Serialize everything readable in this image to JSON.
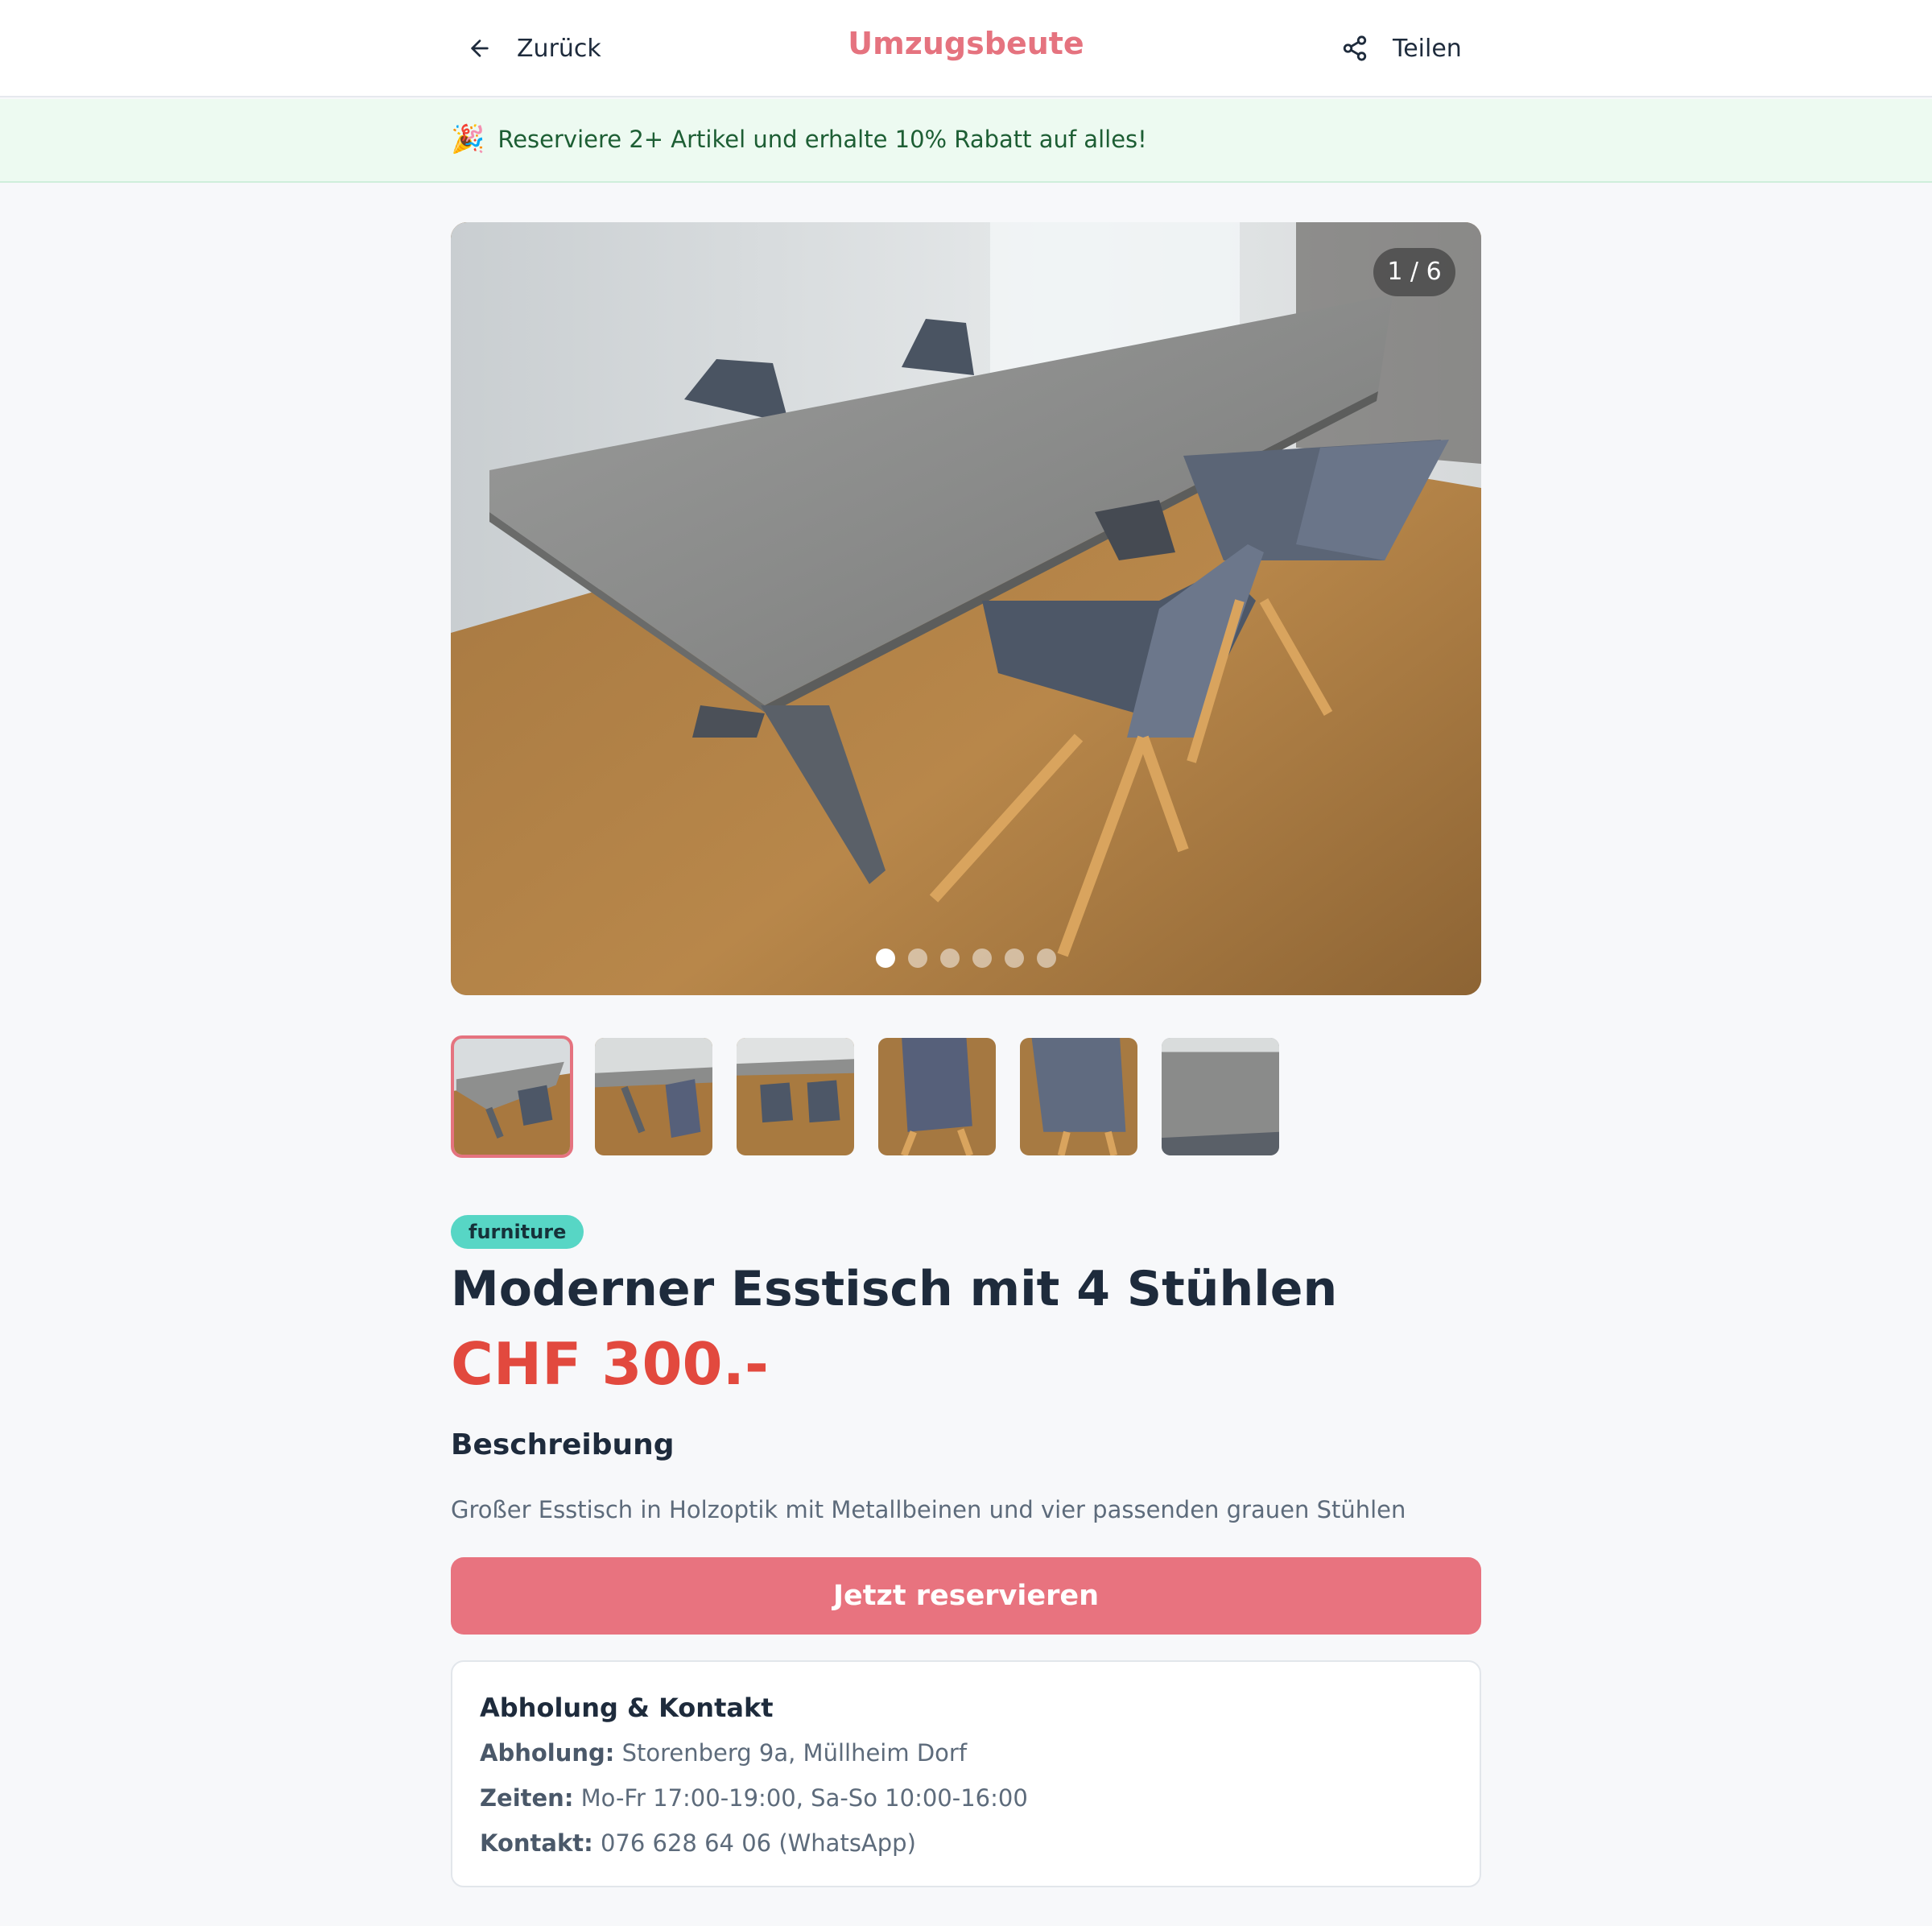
{
  "header": {
    "back_label": "Zurück",
    "brand": "Umzugsbeute",
    "share_label": "Teilen"
  },
  "promo": {
    "icon": "party-popper-icon",
    "text": "Reserviere 2+ Artikel und erhalte 10% Rabatt auf alles!"
  },
  "gallery": {
    "counter": "1 / 6",
    "current": 1,
    "total": 6,
    "thumbnails": [
      "table-chairs-1",
      "table-chairs-2",
      "table-chairs-3",
      "chair-closeup-1",
      "chair-closeup-2",
      "tabletop-closeup"
    ]
  },
  "product": {
    "category": "furniture",
    "title": "Moderner Esstisch mit 4 Stühlen",
    "price": "CHF 300.-",
    "description_heading": "Beschreibung",
    "description": "Großer Esstisch in Holzoptik mit Metallbeinen und vier passenden grauen Stühlen",
    "reserve_label": "Jetzt reservieren"
  },
  "contact": {
    "heading": "Abholung & Kontakt",
    "pickup_label": "Abholung:",
    "pickup_value": "Storenberg 9a, Müllheim Dorf",
    "times_label": "Zeiten:",
    "times_value": "Mo-Fr 17:00-19:00, Sa-So 10:00-16:00",
    "contact_label": "Kontakt:",
    "contact_value": "076 628 64 06 (WhatsApp)"
  },
  "colors": {
    "brand": "#e5737f",
    "price": "#e2493e",
    "badge": "#57d6c5",
    "promo_bg": "#edfaf1",
    "button": "#e8737f"
  }
}
